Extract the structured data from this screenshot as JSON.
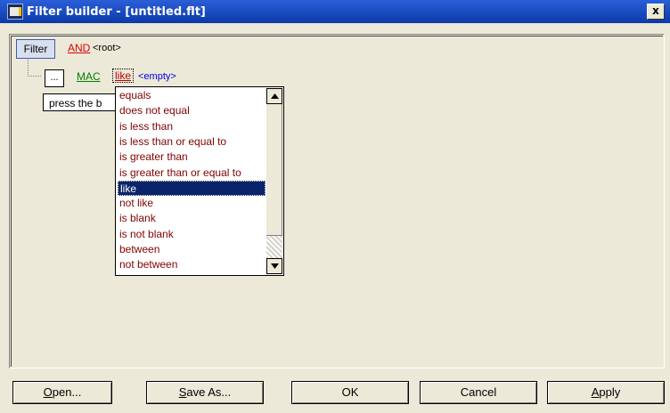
{
  "window": {
    "title": "Filter builder - [untitled.flt]",
    "close_glyph": "x"
  },
  "tree": {
    "filter_button": "Filter",
    "operator": "AND",
    "root_label": "<root>",
    "ellipsis_button": "...",
    "field": "MAC",
    "condition": "like",
    "value": "<empty>",
    "hint_text": "press the b"
  },
  "dropdown": {
    "selected": "like",
    "options": [
      "equals",
      "does not equal",
      "is less than",
      "is less than or equal to",
      "is greater than",
      "is greater than or equal to",
      "like",
      "not like",
      "is blank",
      "is not blank",
      "between",
      "not between"
    ],
    "scroll_up_icon": "triangle-up",
    "scroll_down_icon": "triangle-down"
  },
  "buttons": {
    "open": {
      "accel": "O",
      "rest": "pen..."
    },
    "save_as": {
      "accel": "S",
      "rest": "ave As..."
    },
    "ok": "OK",
    "cancel": "Cancel",
    "apply": {
      "accel": "A",
      "rest": "pply"
    }
  }
}
